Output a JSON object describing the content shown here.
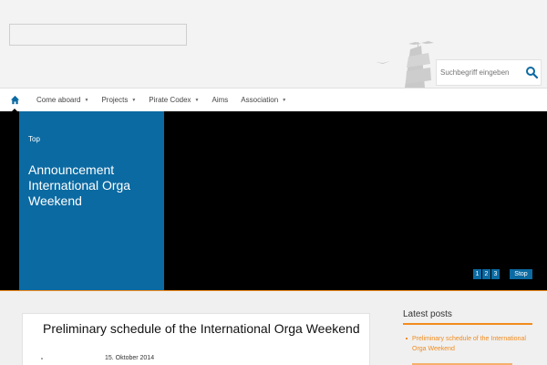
{
  "search": {
    "placeholder": "Suchbegriff eingeben"
  },
  "nav": {
    "items": [
      {
        "label": "Come aboard",
        "has_dropdown": true
      },
      {
        "label": "Projects",
        "has_dropdown": true
      },
      {
        "label": "Pirate Codex",
        "has_dropdown": true
      },
      {
        "label": "Aims",
        "has_dropdown": false
      },
      {
        "label": "Association",
        "has_dropdown": true
      }
    ],
    "caret": "▼"
  },
  "slider": {
    "category": "Top",
    "title": "Announcement International Orga Weekend",
    "pages": [
      "1",
      "2",
      "3"
    ],
    "stop_label": "Stop"
  },
  "post": {
    "title": "Preliminary schedule of the International Orga Weekend",
    "date": "15. Oktober 2014"
  },
  "sidebar": {
    "title": "Latest posts",
    "posts": [
      "Preliminary schedule of the International Orga Weekend"
    ]
  },
  "colors": {
    "accent_blue": "#0b6aa2",
    "accent_orange": "#f28c1e",
    "slider_bg": "#000000"
  },
  "icons": {
    "home": "home-icon",
    "search": "search-icon",
    "ship": "pirate-ship-logo"
  }
}
